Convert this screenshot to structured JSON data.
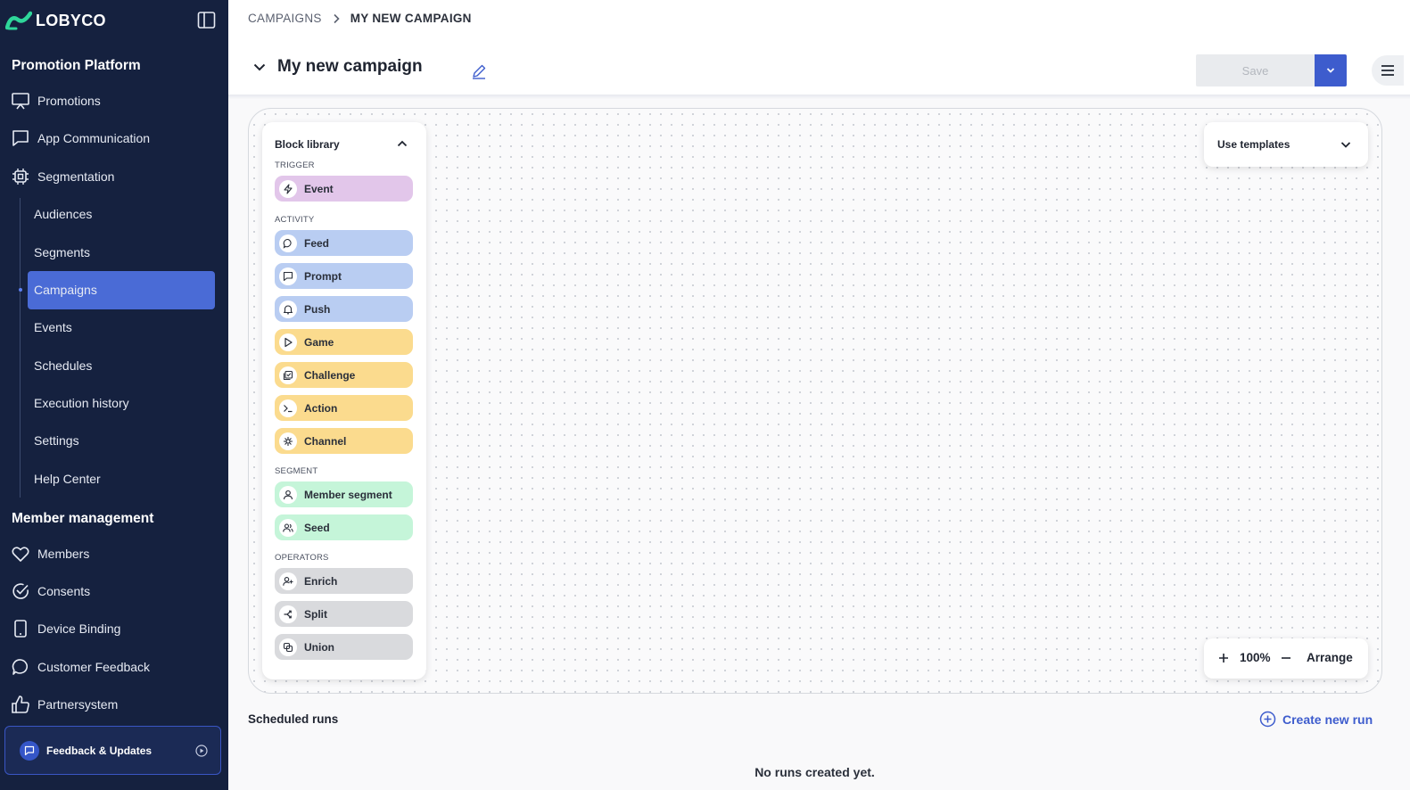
{
  "app": {
    "name": "LOBYCO"
  },
  "sidebar": {
    "section1_title": "Promotion Platform",
    "promotions": "Promotions",
    "app_communication": "App Communication",
    "segmentation": "Segmentation",
    "sub": {
      "audiences": "Audiences",
      "segments": "Segments",
      "campaigns": "Campaigns",
      "events": "Events",
      "schedules": "Schedules",
      "execution_history": "Execution history",
      "settings": "Settings",
      "help_center": "Help Center"
    },
    "section2_title": "Member management",
    "members": "Members",
    "consents": "Consents",
    "device_binding": "Device Binding",
    "customer_feedback": "Customer Feedback",
    "partnersystem": "Partnersystem",
    "feedback_label": "Feedback & Updates"
  },
  "breadcrumb": {
    "parent": "CAMPAIGNS",
    "current": "MY NEW CAMPAIGN"
  },
  "header": {
    "title": "My new campaign",
    "save_label": "Save"
  },
  "library": {
    "title": "Block library",
    "cat_trigger": "TRIGGER",
    "cat_activity": "ACTIVITY",
    "cat_segment": "SEGMENT",
    "cat_operators": "OPERATORS",
    "blocks": {
      "event": "Event",
      "feed": "Feed",
      "prompt": "Prompt",
      "push": "Push",
      "game": "Game",
      "challenge": "Challenge",
      "action": "Action",
      "channel": "Channel",
      "member_segment": "Member segment",
      "seed": "Seed",
      "enrich": "Enrich",
      "split": "Split",
      "union": "Union"
    }
  },
  "colors": {
    "trigger": "#e2c6ea",
    "activity_blue": "#b9cdf2",
    "activity_yellow": "#fbdb8e",
    "segment": "#c5f5d9",
    "operator": "#d9dadd",
    "accent": "#3d5ccd",
    "sidebar_bg": "#15213f"
  },
  "templates": {
    "label": "Use templates"
  },
  "zoom": {
    "level": "100%",
    "arrange_label": "Arrange"
  },
  "runs": {
    "title": "Scheduled runs",
    "create_label": "Create new run",
    "empty_text": "No runs created yet."
  }
}
